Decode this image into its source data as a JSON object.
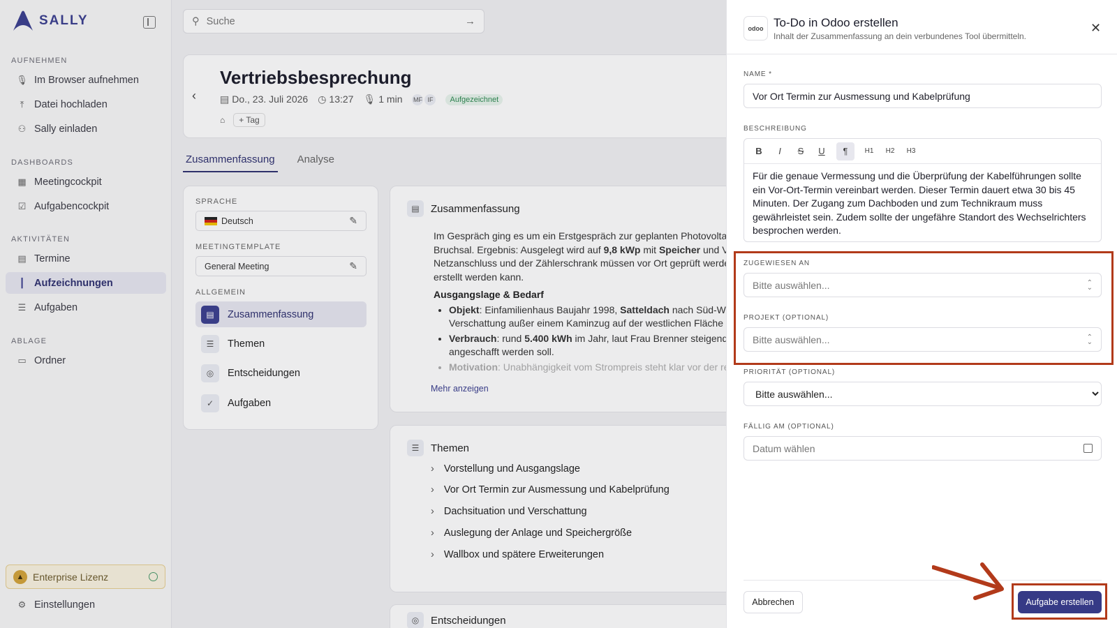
{
  "brand": {
    "name": "SALLY"
  },
  "sidebar": {
    "sections": [
      {
        "title": "AUFNEHMEN",
        "items": [
          {
            "label": "Im Browser aufnehmen",
            "icon": "microphone-icon"
          },
          {
            "label": "Datei hochladen",
            "icon": "upload-icon"
          },
          {
            "label": "Sally einladen",
            "icon": "user-plus-icon"
          }
        ]
      },
      {
        "title": "DASHBOARDS",
        "items": [
          {
            "label": "Meetingcockpit",
            "icon": "grid-icon"
          },
          {
            "label": "Aufgabencockpit",
            "icon": "checkbox-icon"
          }
        ]
      },
      {
        "title": "AKTIVITÄTEN",
        "items": [
          {
            "label": "Termine",
            "icon": "calendar-icon"
          },
          {
            "label": "Aufzeichnungen",
            "icon": "waveform-icon",
            "active": true
          },
          {
            "label": "Aufgaben",
            "icon": "list-check-icon"
          }
        ]
      },
      {
        "title": "ABLAGE",
        "items": [
          {
            "label": "Ordner",
            "icon": "folder-icon"
          }
        ]
      }
    ],
    "license": "Enterprise Lizenz",
    "settings": "Einstellungen"
  },
  "search": {
    "placeholder": "Suche"
  },
  "meeting": {
    "title": "Vertriebsbesprechung",
    "date": "Do., 23. Juli 2026",
    "time": "13:27",
    "duration": "1 min",
    "participants": [
      "MF",
      "IF"
    ],
    "status": "Aufgezeichnet",
    "tag_button": "Tag"
  },
  "tabs": [
    {
      "label": "Zusammenfassung",
      "active": true
    },
    {
      "label": "Analyse"
    }
  ],
  "panel": {
    "language_label": "SPRACHE",
    "language_value": "Deutsch",
    "template_label": "MEETINGTEMPLATE",
    "template_value": "General Meeting",
    "general_label": "ALLGEMEIN",
    "items": [
      {
        "label": "Zusammenfassung",
        "active": true
      },
      {
        "label": "Themen"
      },
      {
        "label": "Entscheidungen"
      },
      {
        "label": "Aufgaben"
      }
    ]
  },
  "summary": {
    "title": "Zusammenfassung",
    "line1": "Im Gespräch ging es um ein Erstgespräch zur geplanten Photovoltai",
    "line2_a": "Bruchsal. Ergebnis: Ausgelegt wird auf ",
    "line2_b": "9,8 kWp",
    "line2_c": " mit ",
    "line2_d": "Speicher",
    "line2_e": " und Vo",
    "line3": "Netzanschluss und der Zählerschrank müssen vor Ort geprüft werde",
    "line4": "erstellt werden kann.",
    "heading": "Ausgangslage & Bedarf",
    "b1_label": "Objekt",
    "b1_text_a": ": Einfamilienhaus Baujahr 1998, ",
    "b1_text_b": "Satteldach",
    "b1_text_c": " nach Süd-Wes",
    "b1_line2": "Verschattung außer einem Kaminzug auf der westlichen Fläche (",
    "b2_label": "Verbrauch",
    "b2_text_a": ": rund ",
    "b2_text_b": "5.400 kWh",
    "b2_text_c": " im Jahr, laut Frau Brenner steigend, c",
    "b2_line2": "angeschafft werden soll.",
    "b3_label": "Motivation",
    "b3_text": ": Unabhängigkeit vom Strompreis steht klar vor der re",
    "more": "Mehr anzeigen"
  },
  "themes": {
    "title": "Themen",
    "items": [
      "Vorstellung und Ausgangslage",
      "Vor Ort Termin zur Ausmessung und Kabelprüfung",
      "Dachsituation und Verschattung",
      "Auslegung der Anlage und Speichergröße",
      "Wallbox und spätere Erweiterungen"
    ]
  },
  "decisions": {
    "title": "Entscheidungen"
  },
  "drawer": {
    "logo_text": "odoo",
    "title": "To-Do in Odoo erstellen",
    "subtitle": "Inhalt der Zusammenfassung an dein verbundenes Tool übermitteln.",
    "name_label": "NAME *",
    "name_value": "Vor Ort Termin zur Ausmessung und Kabelprüfung",
    "description_label": "BESCHREIBUNG",
    "toolbar": [
      "B",
      "I",
      "S",
      "U",
      "¶",
      "H1",
      "H2",
      "H3"
    ],
    "description_text": "Für die genaue Vermessung und die Überprüfung der Kabelführungen sollte ein Vor-Ort-Termin vereinbart werden. Dieser Termin dauert etwa 30 bis 45 Minuten. Der Zugang zum Dachboden und zum Technikraum muss gewährleistet sein. Zudem sollte der ungefähre Standort des Wechselrichters besprochen werden.",
    "assigned_label": "ZUGEWIESEN AN",
    "assigned_placeholder": "Bitte auswählen...",
    "project_label": "PROJEKT (OPTIONAL)",
    "project_placeholder": "Bitte auswählen...",
    "priority_label": "PRIORITÄT (OPTIONAL)",
    "priority_value": "Bitte auswählen...",
    "due_label": "FÄLLIG AM (OPTIONAL)",
    "due_placeholder": "Datum wählen",
    "cancel": "Abbrechen",
    "submit": "Aufgabe erstellen"
  },
  "colors": {
    "accent": "#363a86",
    "annotation": "#b23a1a",
    "status_green": "#2e8a52"
  }
}
